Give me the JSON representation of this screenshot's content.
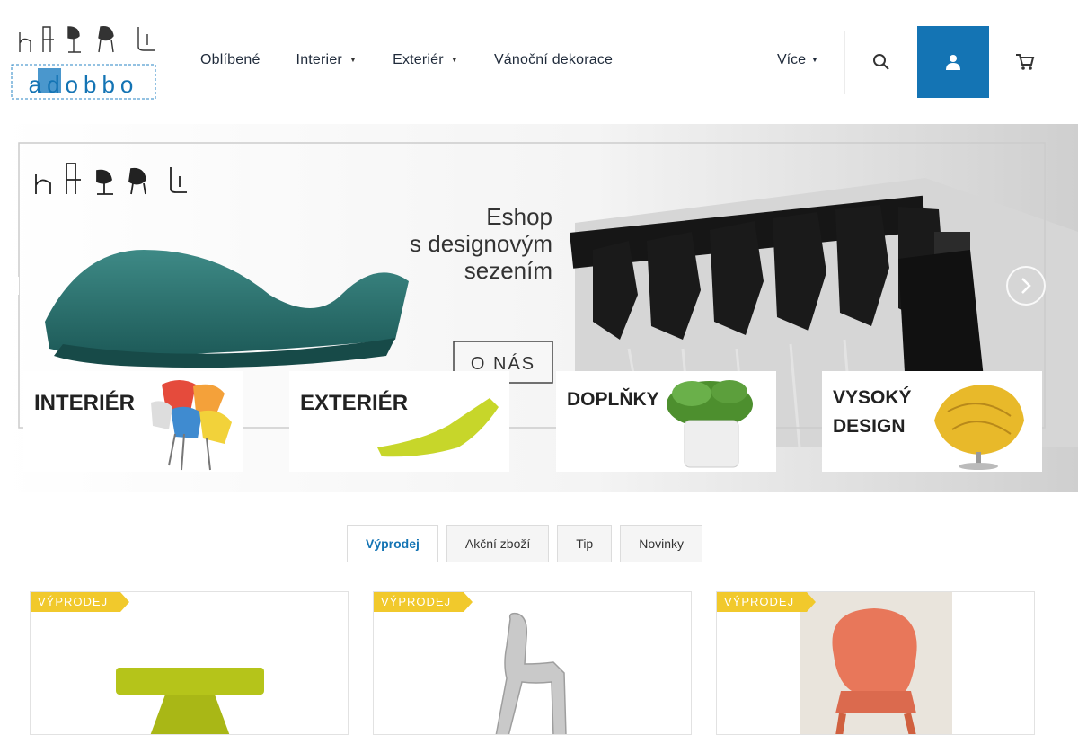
{
  "header": {
    "logo_brand": "adobbo",
    "nav": [
      {
        "label": "Oblíbené",
        "has_dropdown": false
      },
      {
        "label": "Interier",
        "has_dropdown": true
      },
      {
        "label": "Exteriér",
        "has_dropdown": true
      },
      {
        "label": "Vánoční dekorace",
        "has_dropdown": false
      }
    ],
    "more_label": "Více",
    "icons": [
      "search-icon",
      "user-icon",
      "cart-icon"
    ],
    "accent_color": "#1474b4"
  },
  "hero": {
    "slogan_line1": "Eshop",
    "slogan_line2": "s designovým",
    "slogan_line3": "sezením",
    "about_label": "O NÁS",
    "categories": [
      {
        "label": "INTERIÉR"
      },
      {
        "label": "EXTERIÉR"
      },
      {
        "label": "DOPLŇKY"
      },
      {
        "label_line1": "VYSOKÝ",
        "label_line2": "DESIGN"
      }
    ]
  },
  "tabs": [
    {
      "label": "Výprodej",
      "active": true
    },
    {
      "label": "Akční zboží",
      "active": false
    },
    {
      "label": "Tip",
      "active": false
    },
    {
      "label": "Novinky",
      "active": false
    }
  ],
  "products": [
    {
      "badge": "VÝPRODEJ",
      "color": "#b5c41a"
    },
    {
      "badge": "VÝPRODEJ",
      "color": "#c9c9c9"
    },
    {
      "badge": "VÝPRODEJ",
      "color": "#e8775a"
    }
  ],
  "colors": {
    "badge": "#f1c92c",
    "accent": "#1474b4"
  }
}
